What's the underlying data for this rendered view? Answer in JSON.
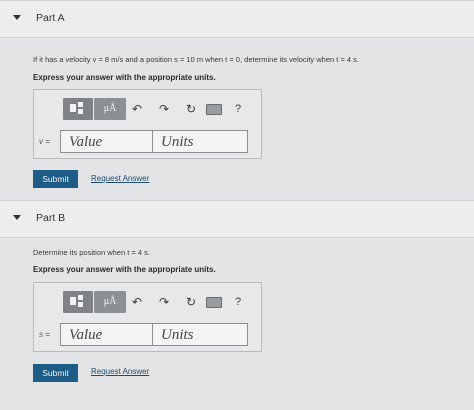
{
  "partA": {
    "title": "Part A",
    "question": "If it has a velocity v = 8 m/s and a position s = 10 m when t = 0, determine its velocity when t = 4 s.",
    "express": "Express your answer with the appropriate units.",
    "toolbar": {
      "mu_label": "μÅ",
      "help_label": "?"
    },
    "var_label": "v =",
    "value_placeholder": "Value",
    "units_placeholder": "Units",
    "submit_label": "Submit",
    "request_label": "Request Answer"
  },
  "partB": {
    "title": "Part B",
    "question": "Determine its position when t = 4 s.",
    "express": "Express your answer with the appropriate units.",
    "toolbar": {
      "mu_label": "μÅ",
      "help_label": "?"
    },
    "var_label": "s =",
    "value_placeholder": "Value",
    "units_placeholder": "Units",
    "submit_label": "Submit",
    "request_label": "Request Answer"
  }
}
